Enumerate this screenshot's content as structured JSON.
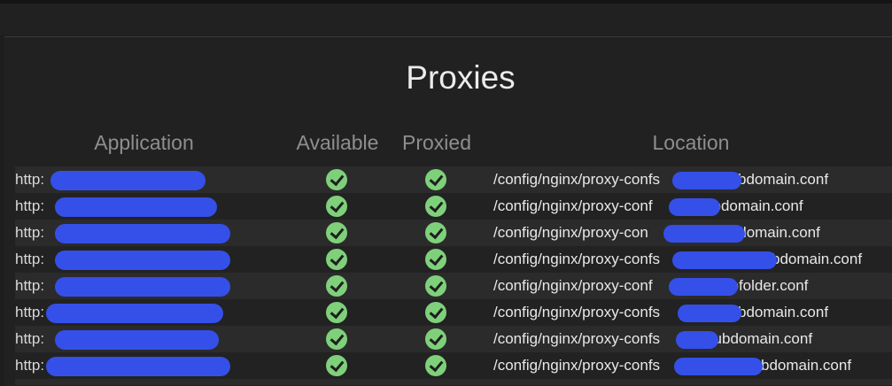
{
  "page": {
    "title": "Proxies"
  },
  "table": {
    "headers": {
      "application": "Application",
      "available": "Available",
      "proxied": "Proxied",
      "location": "Location"
    },
    "rows": [
      {
        "app_prefix": "http:",
        "available": true,
        "proxied": true,
        "location_prefix": "/config/nginx/proxy-confs",
        "location_suffix": "subdomain.conf"
      },
      {
        "app_prefix": "http:",
        "available": true,
        "proxied": true,
        "location_prefix": "/config/nginx/proxy-conf",
        "location_suffix": "subdomain.conf"
      },
      {
        "app_prefix": "http:",
        "available": true,
        "proxied": true,
        "location_prefix": "/config/nginx/proxy-con",
        "location_suffix": "subdomain.conf"
      },
      {
        "app_prefix": "http:",
        "available": true,
        "proxied": true,
        "location_prefix": "/config/nginx/proxy-confs",
        "location_suffix": "subdomain.conf"
      },
      {
        "app_prefix": "http:",
        "available": true,
        "proxied": true,
        "location_prefix": "/config/nginx/proxy-conf",
        "location_suffix": "subfolder.conf"
      },
      {
        "app_prefix": "http:",
        "available": true,
        "proxied": true,
        "location_prefix": "/config/nginx/proxy-confs",
        "location_suffix": "subdomain.conf"
      },
      {
        "app_prefix": "http:",
        "available": true,
        "proxied": true,
        "location_prefix": "/config/nginx/proxy-confs",
        "location_suffix": "subdomain.conf"
      },
      {
        "app_prefix": "http:",
        "available": true,
        "proxied": true,
        "location_prefix": "/config/nginx/proxy-confs",
        "location_suffix": "subdomain.conf"
      }
    ]
  },
  "icons": {
    "available": "check-circle-icon",
    "proxied": "check-circle-icon"
  },
  "colors": {
    "status_ok": "#7ed17a",
    "redaction": "#3550e8"
  }
}
